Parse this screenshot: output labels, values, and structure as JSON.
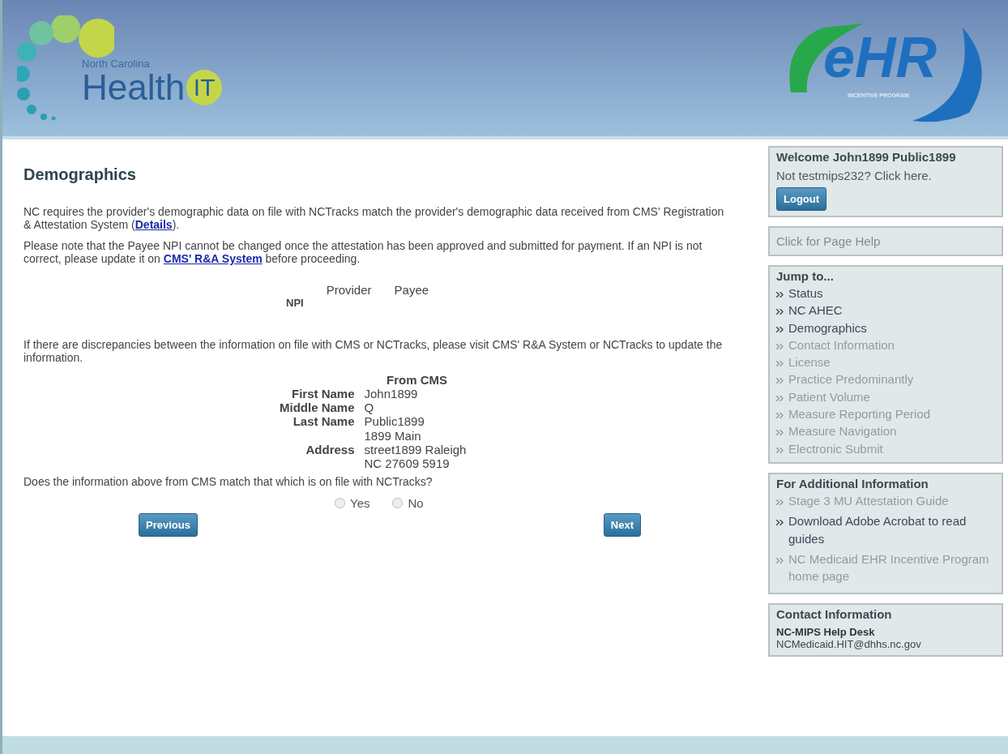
{
  "header": {
    "logo_left": {
      "small": "North Carolina",
      "big": "Health",
      "badge": "IT"
    },
    "logo_right": {
      "big": "eHR",
      "small": "INCENTIVE PROGRAM"
    }
  },
  "main": {
    "title": "Demographics",
    "paragraphs": [
      {
        "before": "NC requires the provider's demographic data on file with NCTracks match the provider's demographic data received from CMS' Registration & Attestation System (",
        "link": "Details",
        "after": ")."
      },
      {
        "before": "Please note that the Payee NPI cannot be changed once the attestation has been approved and submitted for payment. If an NPI is not correct, please update it on ",
        "link": "CMS' R&A System",
        "after": " before proceeding."
      }
    ],
    "npi_table": {
      "columns": [
        "Provider",
        "Payee"
      ],
      "row_label": "NPI"
    },
    "discrepancy_note": "If there are discrepancies between the information on file with CMS or NCTracks, please visit CMS' R&A System or NCTracks to update the information.",
    "cms_table": {
      "heading": "From CMS",
      "rows": [
        {
          "label": "First Name",
          "value": "John1899"
        },
        {
          "label": "Middle Name",
          "value": "Q"
        },
        {
          "label": "Last Name",
          "value": "Public1899"
        },
        {
          "label": "Address",
          "value": "1899 Main street1899 Raleigh NC 27609 5919"
        }
      ]
    },
    "question": "Does the information above from CMS match that which is on file with NCTracks?",
    "options": [
      {
        "label": "Yes",
        "selected": false
      },
      {
        "label": "No",
        "selected": false
      }
    ],
    "buttons": [
      "Previous",
      "Next"
    ]
  },
  "sidebar": {
    "welcome": {
      "title": "Welcome John1899 Public1899",
      "text": "Not testmips232? Click here.",
      "button": "Logout"
    },
    "help": "Click for Page Help",
    "jump": {
      "title": "Jump to...",
      "items": [
        {
          "label": "Status",
          "disabled": false
        },
        {
          "label": "NC AHEC",
          "disabled": false
        },
        {
          "label": "Demographics",
          "disabled": false
        },
        {
          "label": "Contact Information",
          "disabled": true
        },
        {
          "label": "License",
          "disabled": true
        },
        {
          "label": "Practice Predominantly",
          "disabled": true
        },
        {
          "label": "Patient Volume",
          "disabled": true
        },
        {
          "label": "Measure Reporting Period",
          "disabled": true
        },
        {
          "label": "Measure Navigation",
          "disabled": true
        },
        {
          "label": "Electronic Submit",
          "disabled": true
        }
      ]
    },
    "additional": {
      "title": "For Additional Information",
      "items": [
        {
          "label": "Stage 3 MU Attestation Guide",
          "disabled": true
        },
        {
          "label": "Download Adobe Acrobat to read guides",
          "disabled": false
        },
        {
          "label": "NC Medicaid EHR Incentive Program home page",
          "disabled": true
        }
      ]
    },
    "contact": {
      "title": "Contact Information",
      "name": "NC-MIPS Help Desk",
      "email": "NCMedicaid.HIT@dhhs.nc.gov"
    }
  }
}
